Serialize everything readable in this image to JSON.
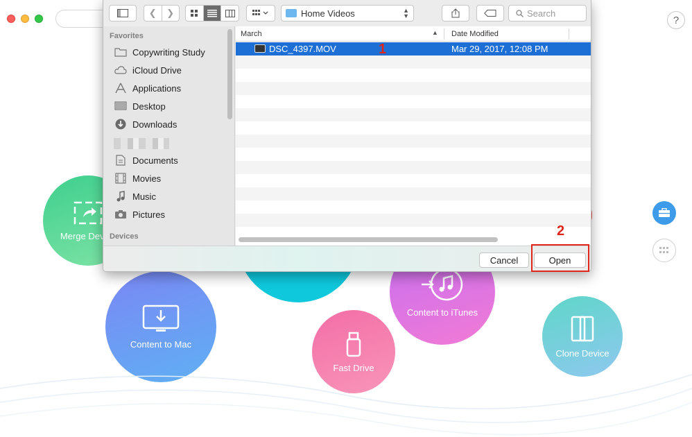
{
  "background_app": {
    "help_label": "?",
    "features": {
      "merge": "Merge Device",
      "content_to_mac": "Content to Mac",
      "content_to_itunes": "Content to iTunes",
      "fast_drive": "Fast Drive",
      "clone_device": "Clone Device"
    }
  },
  "dialog": {
    "toolbar": {
      "path": "Home Videos",
      "search_placeholder": "Search"
    },
    "sidebar": {
      "favorites_header": "Favorites",
      "items": [
        {
          "label": "Copywriting Study",
          "icon": "folder-icon"
        },
        {
          "label": "iCloud Drive",
          "icon": "cloud-icon"
        },
        {
          "label": "Applications",
          "icon": "applications-icon"
        },
        {
          "label": "Desktop",
          "icon": "desktop-icon"
        },
        {
          "label": "Downloads",
          "icon": "downloads-icon"
        },
        {
          "label": "Documents",
          "icon": "documents-icon"
        },
        {
          "label": "Movies",
          "icon": "movies-icon"
        },
        {
          "label": "Music",
          "icon": "music-icon"
        },
        {
          "label": "Pictures",
          "icon": "pictures-icon"
        }
      ],
      "devices_header": "Devices"
    },
    "filelist": {
      "columns": {
        "name": "March",
        "date": "Date Modified"
      },
      "files": [
        {
          "name": "DSC_4397.MOV",
          "date": "Mar 29, 2017, 12:08 PM",
          "selected": true
        }
      ]
    },
    "buttons": {
      "cancel": "Cancel",
      "open": "Open"
    }
  },
  "annotations": {
    "step1": "1",
    "step2": "2",
    "color": "#e0261a"
  }
}
